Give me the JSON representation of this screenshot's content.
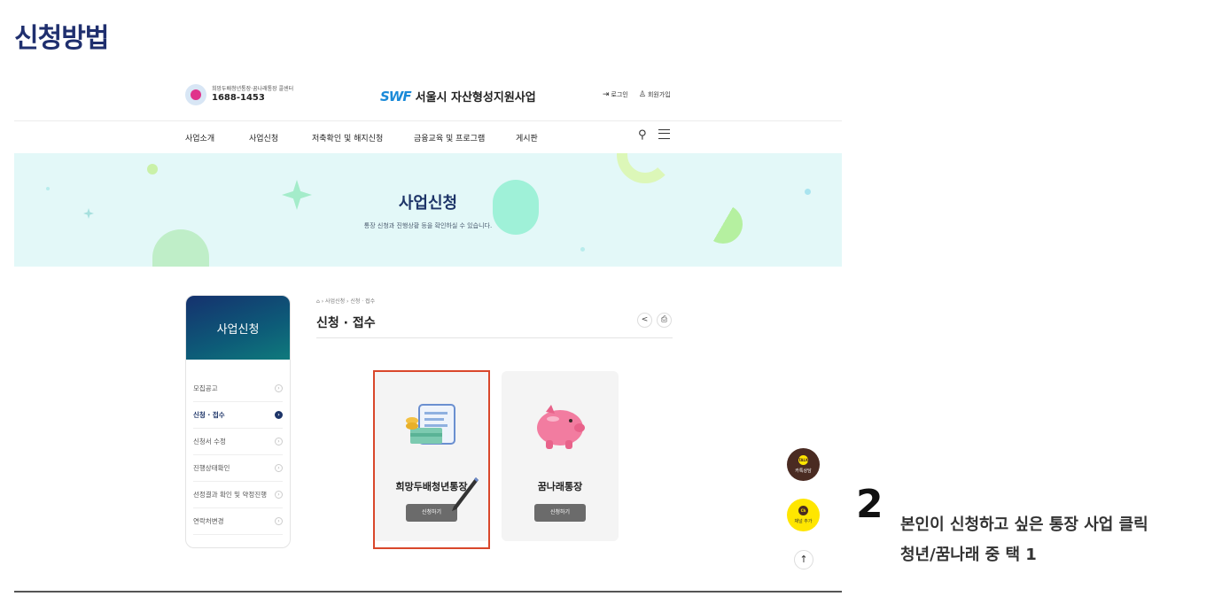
{
  "page": {
    "title": "신청방법"
  },
  "screenshot": {
    "topbar": {
      "hotline_label": "희망두배청년통장·꿈나래통장 콜센터",
      "hotline_number": "1688-1453",
      "logo_mark": "SWF",
      "logo_text": "서울시 자산형성지원사업",
      "login": "로그인",
      "signup": "회원가입"
    },
    "nav": {
      "items": [
        "사업소개",
        "사업신청",
        "저축확인 및 해지신청",
        "금융교육 및 프로그램",
        "게시판"
      ]
    },
    "banner": {
      "title": "사업신청",
      "subtitle": "통장 신청과 진행상황 등을 확인하실 수 있습니다."
    },
    "sidebar": {
      "title": "사업신청",
      "items": [
        {
          "label": "모집공고",
          "active": false
        },
        {
          "label": "신청 · 접수",
          "active": true
        },
        {
          "label": "신청서 수정",
          "active": false
        },
        {
          "label": "진행상태확인",
          "active": false
        },
        {
          "label": "선정결과 확인 및 약정진행",
          "active": false
        },
        {
          "label": "연락처변경",
          "active": false
        }
      ]
    },
    "content": {
      "breadcrumb_home": "⌂",
      "breadcrumb_1": "사업신청",
      "breadcrumb_2": "신청 · 접수",
      "title": "신청 · 접수",
      "cards": [
        {
          "name": "희망두배청년통장",
          "button": "신청하기",
          "icon": "bankbook-icon"
        },
        {
          "name": "꿈나래통장",
          "button": "신청하기",
          "icon": "piggy-bank-icon"
        }
      ]
    },
    "floating": {
      "chat_badge": "TALK",
      "chat_label": "카톡상담",
      "channel_badge": "Ch",
      "channel_label": "채널 추가",
      "top_arrow": "↑"
    }
  },
  "annotation": {
    "step": "2",
    "line1": "본인이 신청하고 싶은 통장 사업 클릭",
    "line2": "청년/꿈나래 중 택 1"
  }
}
